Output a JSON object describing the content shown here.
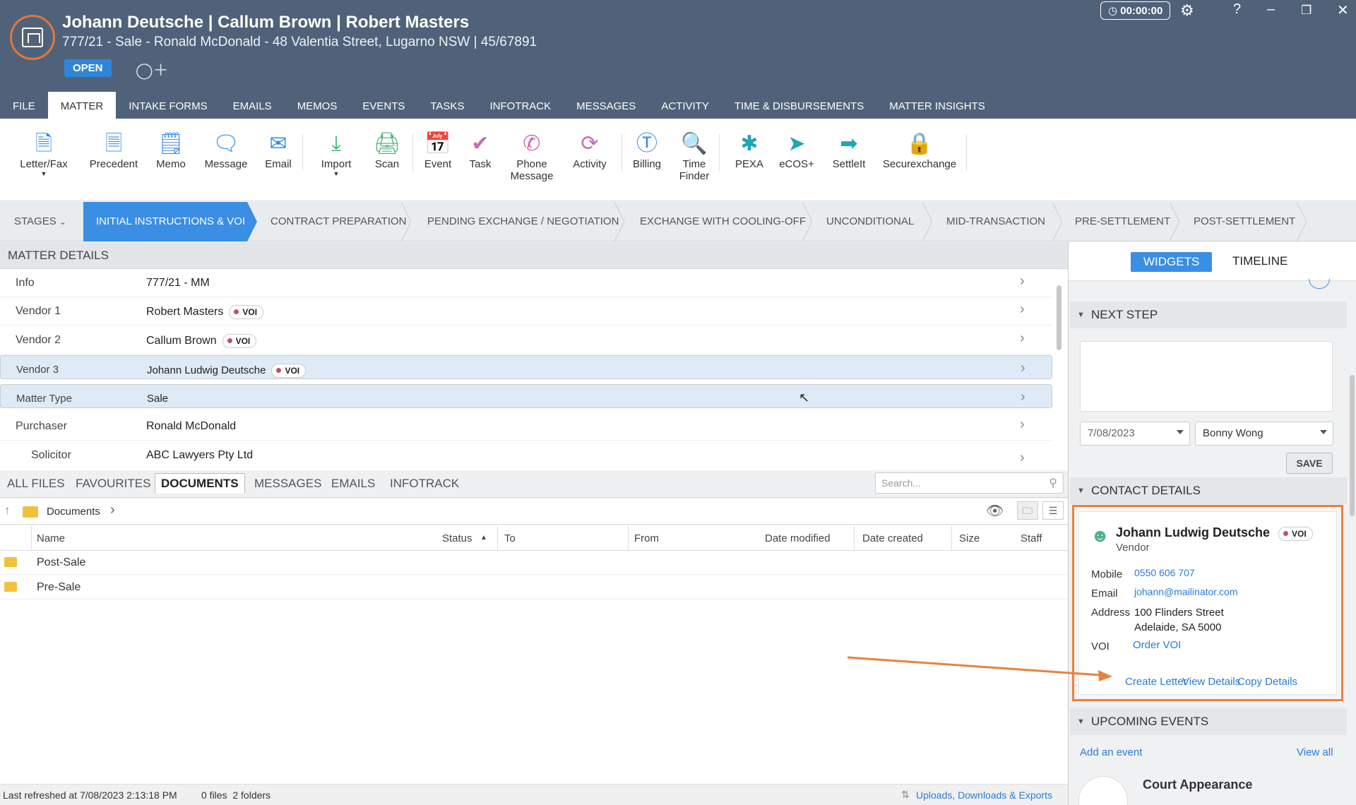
{
  "header": {
    "title": "Johann Deutsche | Callum Brown | Robert Masters",
    "subtitle": "777/21 - Sale - Ronald McDonald - 48 Valentia Street, Lugarno NSW | 45/67891",
    "status_badge": "OPEN",
    "timer": "00:00:00"
  },
  "menu": [
    "FILE",
    "MATTER",
    "INTAKE FORMS",
    "EMAILS",
    "MEMOS",
    "EVENTS",
    "TASKS",
    "INFOTRACK",
    "MESSAGES",
    "ACTIVITY",
    "TIME & DISBURSEMENTS",
    "MATTER INSIGHTS"
  ],
  "ribbon": {
    "letter_fax": "Letter/Fax",
    "precedent": "Precedent",
    "memo": "Memo",
    "message": "Message",
    "email": "Email",
    "import": "Import",
    "scan": "Scan",
    "event": "Event",
    "task": "Task",
    "phone_message_1": "Phone",
    "phone_message_2": "Message",
    "activity": "Activity",
    "billing": "Billing",
    "time_finder_1": "Time",
    "time_finder_2": "Finder",
    "pexa": "PEXA",
    "ecos": "eCOS+",
    "settleit": "SettleIt",
    "securexchange": "Securexchange"
  },
  "stages": {
    "label": "STAGES",
    "items": [
      "INITIAL INSTRUCTIONS & VOI",
      "CONTRACT PREPARATION",
      "PENDING EXCHANGE / NEGOTIATION",
      "EXCHANGE WITH COOLING-OFF",
      "UNCONDITIONAL",
      "MID-TRANSACTION",
      "PRE-SETTLEMENT",
      "POST-SETTLEMENT"
    ]
  },
  "matter_details": {
    "heading": "MATTER DETAILS",
    "voi": "VOI",
    "rows": [
      {
        "key": "Info",
        "value": "777/21 - MM"
      },
      {
        "key": "Vendor 1",
        "value": "Robert Masters"
      },
      {
        "key": "Vendor 2",
        "value": "Callum Brown"
      },
      {
        "key": "Vendor 3",
        "value": "Johann Ludwig Deutsche"
      },
      {
        "key": "Matter Type",
        "value": "Sale"
      },
      {
        "key": "Purchaser",
        "value": "Ronald McDonald"
      },
      {
        "key": "Solicitor",
        "value": "ABC Lawyers Pty Ltd"
      }
    ]
  },
  "doc_tabs": [
    "ALL FILES",
    "FAVOURITES",
    "DOCUMENTS",
    "MESSAGES",
    "EMAILS",
    "INFOTRACK"
  ],
  "search_placeholder": "Search...",
  "breadcrumb": "Documents",
  "columns": [
    "Name",
    "Status",
    "To",
    "From",
    "Date modified",
    "Date created",
    "Size",
    "Staff"
  ],
  "files": [
    "Post-Sale",
    "Pre-Sale"
  ],
  "status_bar": {
    "refreshed": "Last refreshed at 7/08/2023 2:13:18 PM",
    "counts": "0 files  2 folders",
    "uploads": "Uploads, Downloads & Exports"
  },
  "right_panel": {
    "tab_widgets": "WIDGETS",
    "tab_timeline": "TIMELINE",
    "next_step": {
      "heading": "NEXT STEP",
      "date": "7/08/2023",
      "assignee": "Bonny Wong",
      "save": "SAVE"
    },
    "contact": {
      "heading": "CONTACT DETAILS",
      "name": "Johann Ludwig Deutsche",
      "voi": "VOI",
      "role": "Vendor",
      "mobile_label": "Mobile",
      "mobile": "0550 606 707",
      "email_label": "Email",
      "email": "johann@mailinator.com",
      "address_label": "Address",
      "address_1": "100 Flinders Street",
      "address_2": "Adelaide, SA 5000",
      "voi_label": "VOI",
      "order_voi": "Order VOI",
      "create_letter": "Create Letter",
      "view_details": "View Details",
      "copy_details": "Copy Details"
    },
    "events": {
      "heading": "UPCOMING EVENTS",
      "add": "Add an event",
      "view_all": "View all",
      "first_event": "Court Appearance"
    }
  },
  "colors": {
    "header_bg": "#4f6279",
    "accent_blue": "#3a8ee3",
    "highlight_orange": "#e8823f",
    "link_blue": "#2b7bd4"
  }
}
